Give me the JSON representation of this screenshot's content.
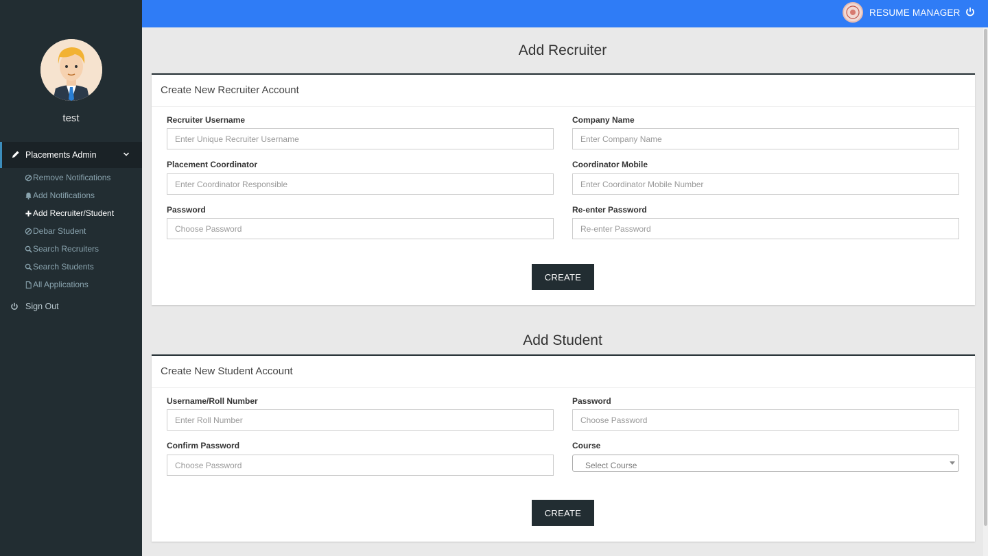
{
  "user": {
    "name": "test"
  },
  "sidebar": {
    "menu_header": "Placements Admin",
    "items": [
      {
        "label": "Remove Notifications",
        "icon": "ban-icon"
      },
      {
        "label": "Add Notifications",
        "icon": "bell-icon"
      },
      {
        "label": "Add Recruiter/Student",
        "icon": "plus-icon",
        "active": true
      },
      {
        "label": "Debar Student",
        "icon": "ban-icon"
      },
      {
        "label": "Search Recruiters",
        "icon": "search-icon"
      },
      {
        "label": "Search Students",
        "icon": "search-icon"
      },
      {
        "label": "All Applications",
        "icon": "file-icon"
      }
    ],
    "signout": "Sign Out"
  },
  "topbar": {
    "brand": "RESUME MANAGER"
  },
  "recruiter": {
    "section_title": "Add Recruiter",
    "panel_title": "Create New Recruiter Account",
    "fields": {
      "username": {
        "label": "Recruiter Username",
        "placeholder": "Enter Unique Recruiter Username"
      },
      "company": {
        "label": "Company Name",
        "placeholder": "Enter Company Name"
      },
      "coordinator": {
        "label": "Placement Coordinator",
        "placeholder": "Enter Coordinator Responsible"
      },
      "mobile": {
        "label": "Coordinator Mobile",
        "placeholder": "Enter Coordinator Mobile Number"
      },
      "password": {
        "label": "Password",
        "placeholder": "Choose Password"
      },
      "repassword": {
        "label": "Re-enter Password",
        "placeholder": "Re-enter Password"
      }
    },
    "button": "CREATE"
  },
  "student": {
    "section_title": "Add Student",
    "panel_title": "Create New Student Account",
    "fields": {
      "roll": {
        "label": "Username/Roll Number",
        "placeholder": "Enter Roll Number"
      },
      "password": {
        "label": "Password",
        "placeholder": "Choose Password"
      },
      "confirm": {
        "label": "Confirm Password",
        "placeholder": "Choose Password"
      },
      "course": {
        "label": "Course",
        "value": "Select Course"
      }
    },
    "button": "CREATE"
  }
}
